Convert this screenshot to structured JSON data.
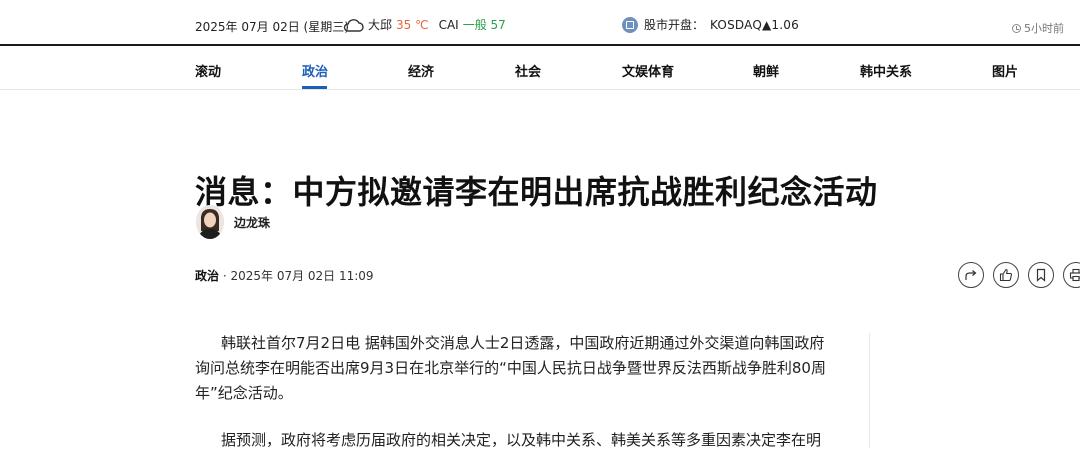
{
  "topbar": {
    "date": "2025年 07月 02日 (星期三)",
    "weather": {
      "icon": "cloud-icon",
      "city": "大邱",
      "temp": "35 ℃",
      "cai_label": "CAI",
      "cai_value": "一般 57"
    },
    "stock": {
      "icon": "stock-chart-icon",
      "label": "股市开盘：",
      "index": "KOSDAQ▲1.06"
    },
    "updated": "5小时前"
  },
  "nav": {
    "items": [
      "滚动",
      "政治",
      "经济",
      "社会",
      "文娱体育",
      "朝鲜",
      "韩中关系",
      "图片"
    ],
    "active": "政治"
  },
  "article": {
    "headline": "消息：中方拟邀请李在明出席抗战胜利纪念活动",
    "author": "边龙珠",
    "section": "政治",
    "datetime": " · 2025年 07月 02日 11:09",
    "paragraphs": [
      "韩联社首尔7月2日电 据韩国外交消息人士2日透露，中国政府近期通过外交渠道向韩国政府询问总统李在明能否出席9月3日在北京举行的“中国人民抗日战争暨世界反法西斯战争胜利80周年”纪念活动。",
      "据预测，政府将考虑历届政府的相关决定，以及韩中关系、韩美关系等多重因素决定李在明"
    ]
  },
  "actions": [
    "share-icon",
    "like-icon",
    "bookmark-icon",
    "print-icon"
  ],
  "colors": {
    "accent": "#1c5fb8",
    "temp": "#e8643b",
    "cai": "#2ba04a"
  }
}
